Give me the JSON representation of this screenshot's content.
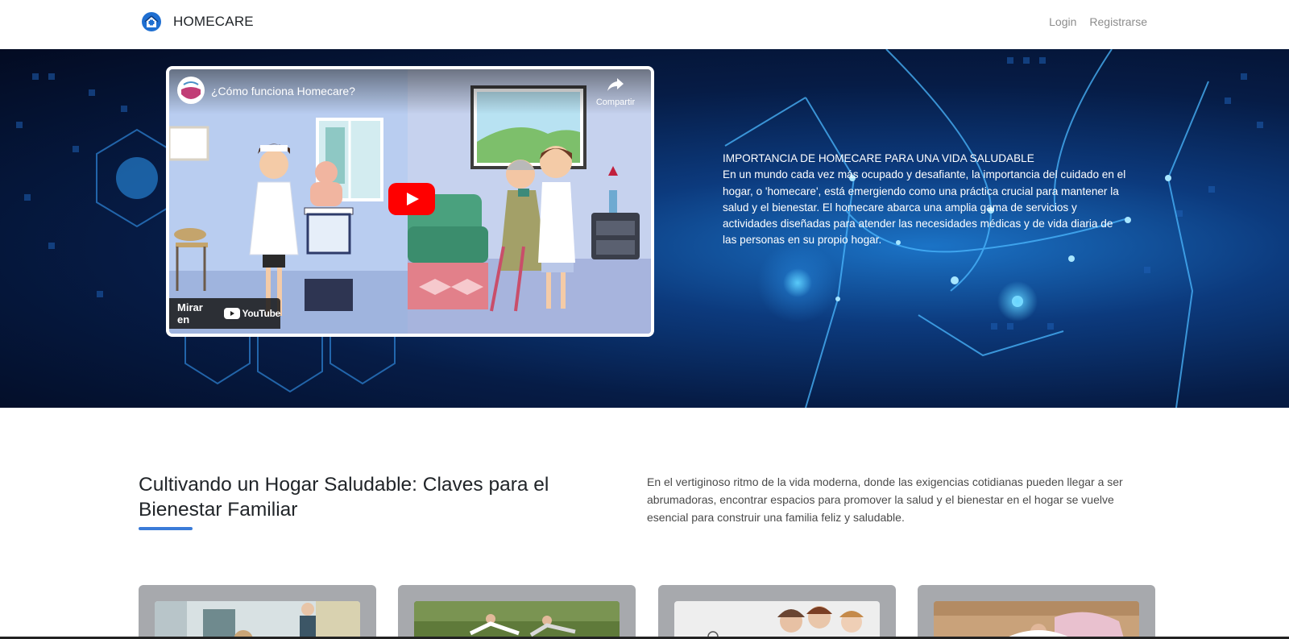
{
  "navbar": {
    "brand_name": "HOMECARE",
    "brand_icon": "house-medical-icon",
    "links": [
      {
        "label": "Login"
      },
      {
        "label": "Registrarse"
      }
    ]
  },
  "hero": {
    "video": {
      "title": "¿Cómo funciona Homecare?",
      "share_label": "Compartir",
      "watch_on_label": "Mirar en",
      "platform_name": "YouTube"
    },
    "heading": "IMPORTANCIA DE HOMECARE PARA UNA VIDA SALUDABLE",
    "body": "En un mundo cada vez más ocupado y desafiante, la importancia del cuidado en el hogar, o 'homecare', está emergiendo como una práctica crucial para mantener la salud y el bienestar. El homecare abarca una amplia gama de servicios y actividades diseñadas para atender las necesidades médicas y de vida diaria de las personas en su propio hogar."
  },
  "section": {
    "title": "Cultivando un Hogar Saludable: Claves para el Bienestar Familiar",
    "description": "En el vertiginoso ritmo de la vida moderna, donde las exigencias cotidianas pueden llegar a ser abrumadoras, encontrar espacios para promover la salud y el bienestar en el hogar se vuelve esencial para construir una familia feliz y saludable."
  },
  "colors": {
    "accent": "#3b7bd8",
    "hero_dark": "#061c46",
    "hero_glow": "#1b73c6",
    "card_bg": "#a7a9ad",
    "youtube_red": "#ff0000"
  }
}
